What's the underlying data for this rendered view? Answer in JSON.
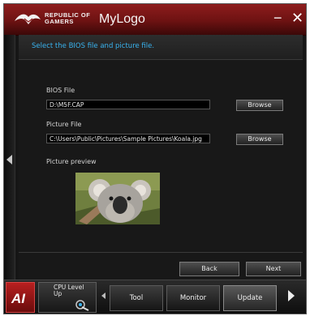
{
  "window": {
    "brand_line1": "REPUBLIC OF",
    "brand_line2": "GAMERS",
    "title": "MyLogo",
    "minimize": "−",
    "close": "✕"
  },
  "instruction": "Select the BIOS file and picture file.",
  "bios": {
    "label": "BIOS File",
    "value": "D:\\M5F.CAP",
    "browse": "Browse"
  },
  "picture": {
    "label": "Picture File",
    "value": "C:\\Users\\Public\\Pictures\\Sample Pictures\\Koala.jpg",
    "browse": "Browse"
  },
  "preview": {
    "label": "Picture preview"
  },
  "nav": {
    "back": "Back",
    "next": "Next"
  },
  "dock": {
    "ai_logo": "AI",
    "cpu_label": "CPU Level Up",
    "tabs": [
      "Tool",
      "Monitor",
      "Update"
    ],
    "active_tab": "Update"
  },
  "colors": {
    "title_red": "#8e1d1d",
    "accent_blue": "#39b3ef",
    "background": "#181818"
  }
}
